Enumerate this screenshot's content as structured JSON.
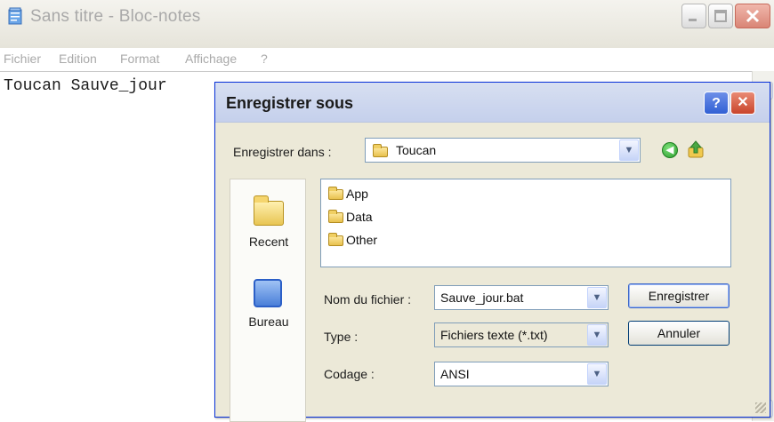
{
  "notepad": {
    "title": "Sans titre - Bloc-notes",
    "menu": [
      "Fichier",
      "Edition",
      "Format",
      "Affichage",
      "?"
    ],
    "content": "Toucan Sauve_jour"
  },
  "dialog": {
    "title": "Enregistrer sous",
    "help_label": "?",
    "close_label": "✕",
    "save_in_label": "Enregistrer dans :",
    "save_in_value": "Toucan",
    "places": [
      {
        "label": "Recent",
        "icon": "recent-folder-icon"
      },
      {
        "label": "Bureau",
        "icon": "desktop-icon"
      }
    ],
    "files": [
      "App",
      "Data",
      "Other"
    ],
    "filename_label": "Nom du fichier :",
    "filename_value": "Sauve_jour.bat",
    "type_label": "Type :",
    "type_value": "Fichiers texte (*.txt)",
    "encoding_label": "Codage :",
    "encoding_value": "ANSI",
    "save_button": "Enregistrer",
    "cancel_button": "Annuler"
  },
  "colors": {
    "dialog_border": "#0831d9",
    "dialog_bg": "#ece9d8",
    "close_red": "#c9452b"
  }
}
